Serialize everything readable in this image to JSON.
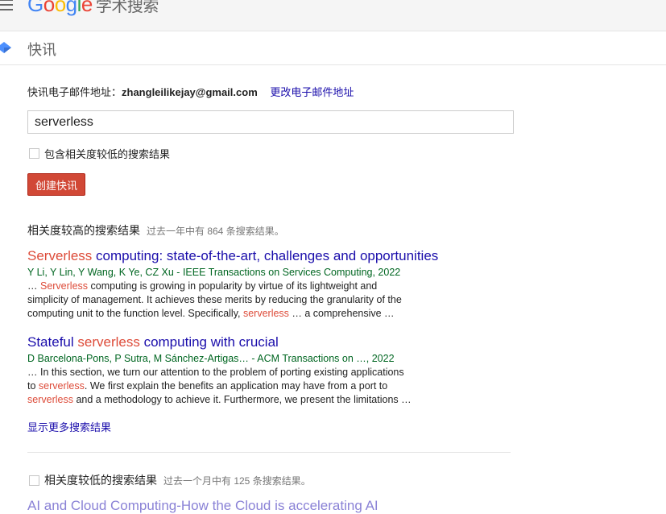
{
  "header": {
    "logo": {
      "g1": "G",
      "o1": "o",
      "o2": "o",
      "g2": "g",
      "l": "l",
      "e": "e"
    },
    "logo_suffix": "学术搜索"
  },
  "subbar": {
    "title": "快讯"
  },
  "email": {
    "label": "快讯电子邮件地址：",
    "address": "zhangleilikejay@gmail.com",
    "change_link": "更改电子邮件地址"
  },
  "query": {
    "value": "serverless"
  },
  "include_low": {
    "label": "包含相关度较低的搜索结果",
    "checked": false
  },
  "create_button": "创建快讯",
  "high_section": {
    "title": "相关度较高的搜索结果",
    "count": "过去一年中有 864 条搜索结果。"
  },
  "results": [
    {
      "title_hl": "Serverless",
      "title_rest": " computing: state-of-the-art, challenges and opportunities",
      "meta": "Y Li, Y Lin, Y Wang, K Ye, CZ Xu - IEEE Transactions on Services Computing, 2022",
      "s1a": "… ",
      "s1hl": "Serverless",
      "s1b": " computing is growing in popularity by virtue of its lightweight and",
      "s2": "simplicity of management. It achieves these merits by reducing the granularity of the",
      "s3a": "computing unit to the function level. Specifically, ",
      "s3hl": "serverless",
      "s3b": " … a comprehensive …"
    },
    {
      "title_a": "Stateful ",
      "title_hl": "serverless",
      "title_b": " computing with crucial",
      "meta": "D Barcelona-Pons, P Sutra, M Sánchez-Artigas… - ACM Transactions on …, 2022",
      "s1": "… In this section, we turn our attention to the problem of porting existing applications",
      "s2a": "to ",
      "s2hl": "serverless",
      "s2b": ". We first explain the benefits an application may have from a port to",
      "s3hl": "serverless",
      "s3b": " and a methodology to achieve it. Furthermore, we present the limitations …"
    }
  ],
  "more_link": "显示更多搜索结果",
  "low_section": {
    "title": "相关度较低的搜索结果",
    "count": "过去一个月中有 125 条搜索结果。"
  },
  "low_result": {
    "title": "AI and Cloud Computing-How the Cloud is accelerating AI"
  }
}
